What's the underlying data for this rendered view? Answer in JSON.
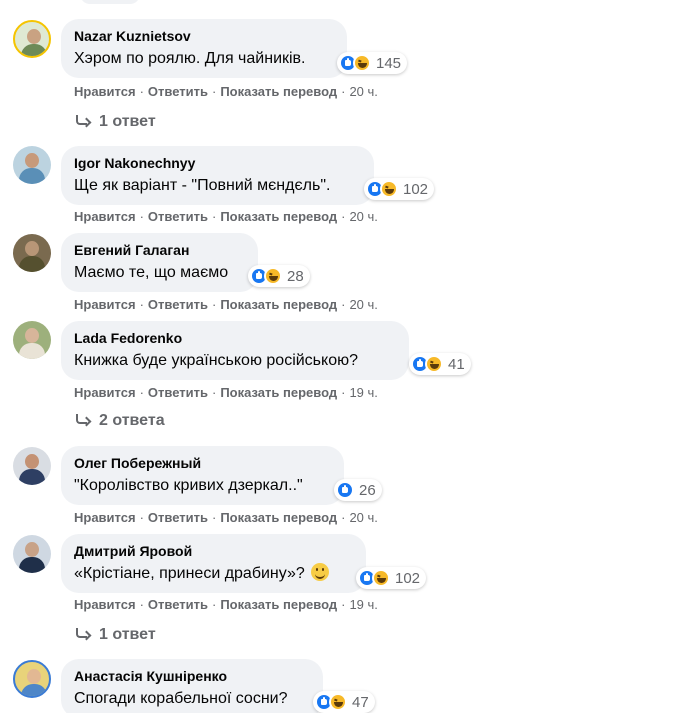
{
  "actions": {
    "like": "Нравится",
    "reply": "Ответить",
    "translate": "Показать перевод",
    "separator": "·"
  },
  "colors": {
    "bubble": "#f0f2f5",
    "secondary_text": "#65676b",
    "like_blue": "#1877f2",
    "haha_yellow": "#f7b928"
  },
  "comments": [
    {
      "name": "Nazar Kuznietsov",
      "text": "Хэром по роялю. Для чайників.",
      "reactions": [
        "like-icon",
        "haha-icon"
      ],
      "count": "145",
      "time": "20 ч.",
      "replies": "1 ответ"
    },
    {
      "name": "Igor Nakonechnyy",
      "text": "Ще як варіант - \"Повний мєндєль\".",
      "reactions": [
        "like-icon",
        "haha-icon"
      ],
      "count": "102",
      "time": "20 ч.",
      "replies": ""
    },
    {
      "name": "Евгений Галаган",
      "text": "Маємо те, що маємо",
      "reactions": [
        "like-icon",
        "haha-icon"
      ],
      "count": "28",
      "time": "20 ч.",
      "replies": ""
    },
    {
      "name": "Lada Fedorenko",
      "text": "Книжка буде українською російською?",
      "reactions": [
        "like-icon",
        "haha-icon"
      ],
      "count": "41",
      "time": "19 ч.",
      "replies": "2 ответа"
    },
    {
      "name": "Олег Побережный",
      "text": "\"Королівство кривих дзеркал..\"",
      "reactions": [
        "like-icon"
      ],
      "count": "26",
      "time": "20 ч.",
      "replies": ""
    },
    {
      "name": "Дмитрий Яровой",
      "text": "«Крістіане, принеси драбину»?",
      "emoji": "smiling-face-icon",
      "reactions": [
        "like-icon",
        "haha-icon"
      ],
      "count": "102",
      "time": "19 ч.",
      "replies": "1 ответ"
    },
    {
      "name": "Анастасія Кушніренко",
      "text": "Спогади корабельної сосни?",
      "reactions": [
        "like-icon",
        "haha-icon"
      ],
      "count": "47",
      "time": "",
      "replies": ""
    }
  ]
}
